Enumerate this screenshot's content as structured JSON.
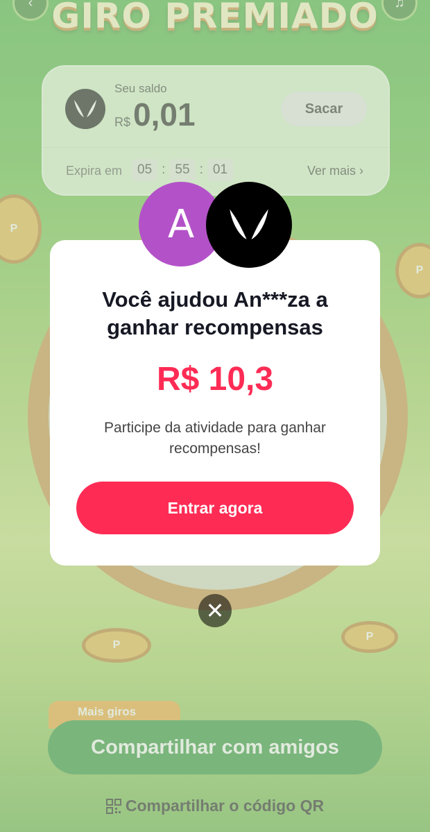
{
  "game": {
    "title": "GIRO PREMIADO",
    "back_icon": "chevron-left-icon",
    "music_icon": "music-note-icon"
  },
  "balance": {
    "label": "Seu saldo",
    "currency": "R$",
    "value": "0,01",
    "withdraw_label": "Sacar",
    "expires_label": "Expira em",
    "timer": [
      "05",
      "55",
      "01"
    ],
    "timer_sep": ":",
    "see_more_label": "Ver mais"
  },
  "bottom": {
    "badge_label": "Mais giros",
    "share_label": "Compartilhar com amigos",
    "qr_label": "Compartilhar o código QR"
  },
  "modal": {
    "friend_initial": "A",
    "title_line1": "Você ajudou An***za a",
    "title_line2": "ganhar recompensas",
    "amount": "R$ 10,3",
    "desc_line1": "Participe da atividade para ganhar",
    "desc_line2": "recompensas!",
    "cta_label": "Entrar agora",
    "close_icon": "close-icon"
  },
  "colors": {
    "accent": "#fe2c55",
    "friend_avatar": "#b352c8",
    "share_green": "#1c8a2a"
  }
}
